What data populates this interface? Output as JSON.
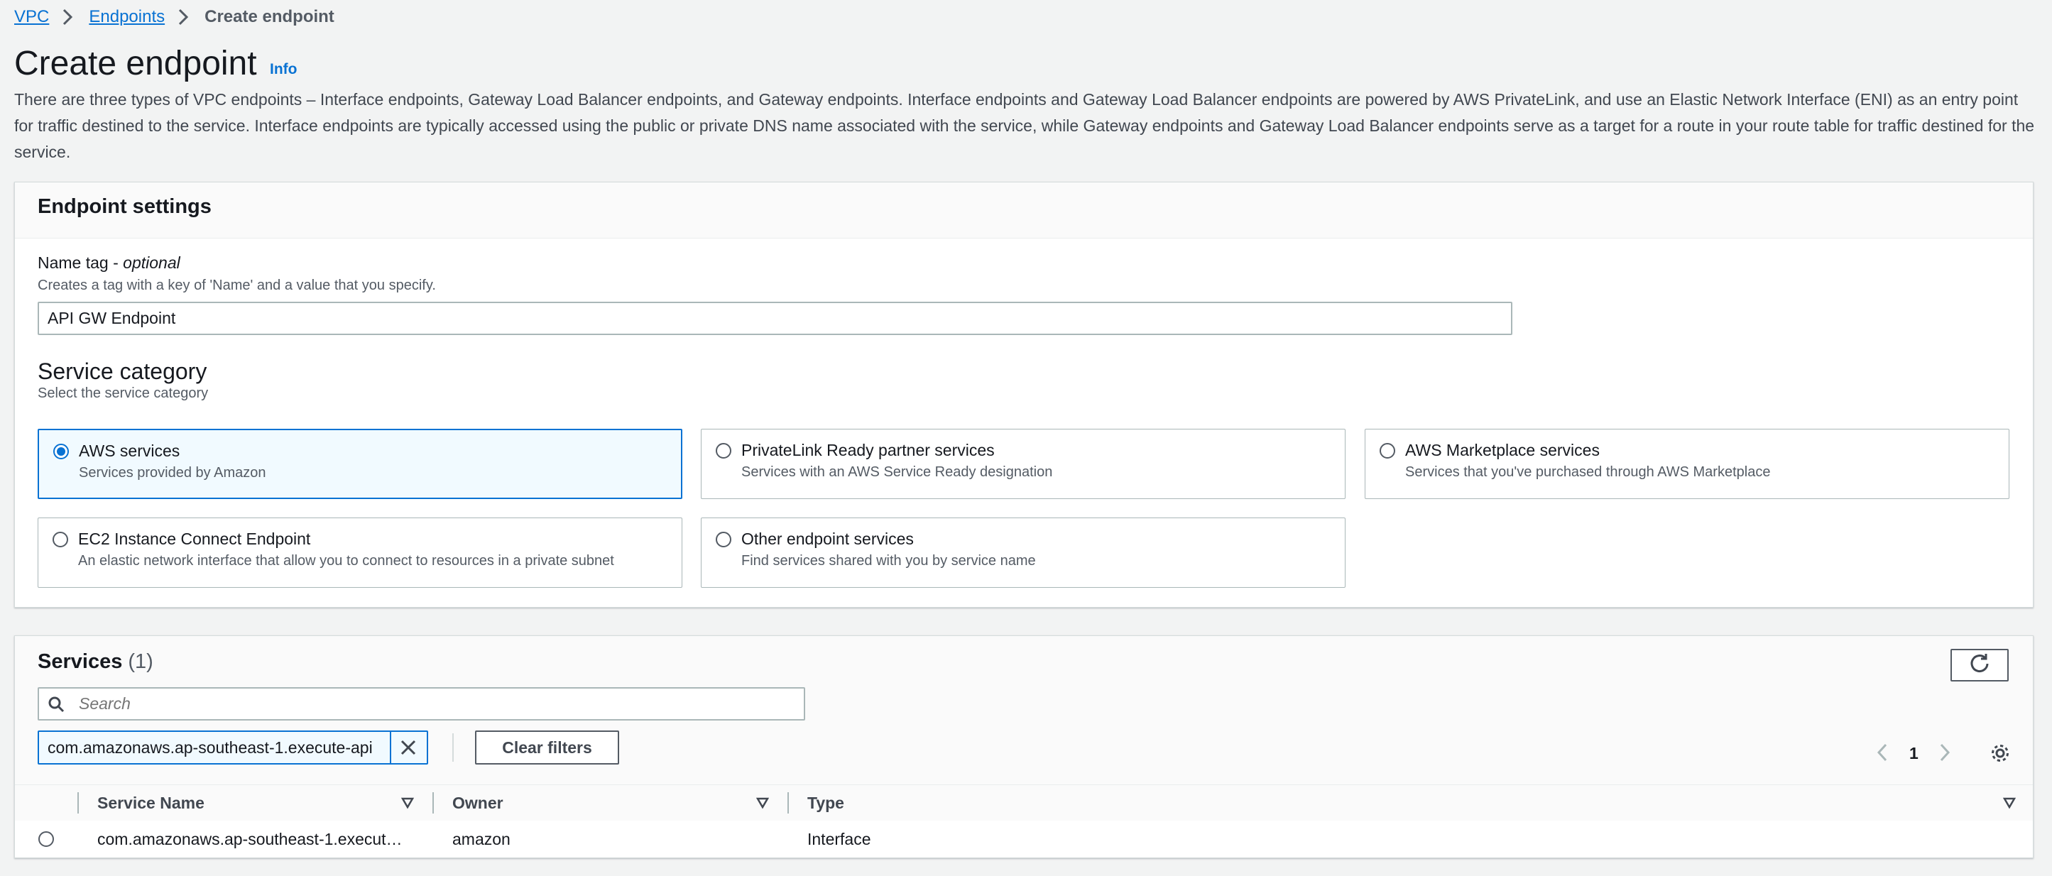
{
  "breadcrumb": {
    "items": [
      "VPC",
      "Endpoints"
    ],
    "current": "Create endpoint"
  },
  "header": {
    "title": "Create endpoint",
    "info": "Info",
    "description": "There are three types of VPC endpoints – Interface endpoints, Gateway Load Balancer endpoints, and Gateway endpoints. Interface endpoints and Gateway Load Balancer endpoints are powered by AWS PrivateLink, and use an Elastic Network Interface (ENI) as an entry point for traffic destined to the service. Interface endpoints are typically accessed using the public or private DNS name associated with the service, while Gateway endpoints and Gateway Load Balancer endpoints serve as a target for a route in your route table for traffic destined for the service."
  },
  "settings": {
    "title": "Endpoint settings",
    "name_tag": {
      "label": "Name tag - ",
      "label_optional": "optional",
      "hint": "Creates a tag with a key of 'Name' and a value that you specify.",
      "value": "API GW Endpoint"
    },
    "service_category": {
      "title": "Service category",
      "hint": "Select the service category",
      "options": [
        {
          "label": "AWS services",
          "desc": "Services provided by Amazon",
          "selected": true
        },
        {
          "label": "PrivateLink Ready partner services",
          "desc": "Services with an AWS Service Ready designation",
          "selected": false
        },
        {
          "label": "AWS Marketplace services",
          "desc": "Services that you've purchased through AWS Marketplace",
          "selected": false
        },
        {
          "label": "EC2 Instance Connect Endpoint",
          "desc": "An elastic network interface that allow you to connect to resources in a private subnet",
          "selected": false
        },
        {
          "label": "Other endpoint services",
          "desc": "Find services shared with you by service name",
          "selected": false
        }
      ]
    }
  },
  "services": {
    "title": "Services",
    "count": "(1)",
    "search_placeholder": "Search",
    "filter_value": "com.amazonaws.ap-southeast-1.execute-api",
    "clear_filters": "Clear filters",
    "page": "1",
    "columns": [
      "Service Name",
      "Owner",
      "Type"
    ],
    "rows": [
      {
        "service_name": "com.amazonaws.ap-southeast-1.execut…",
        "owner": "amazon",
        "type": "Interface"
      }
    ]
  },
  "colors": {
    "accent": "#0972d3",
    "selected_bg": "#f1faff",
    "page_bg": "#f2f3f3"
  }
}
